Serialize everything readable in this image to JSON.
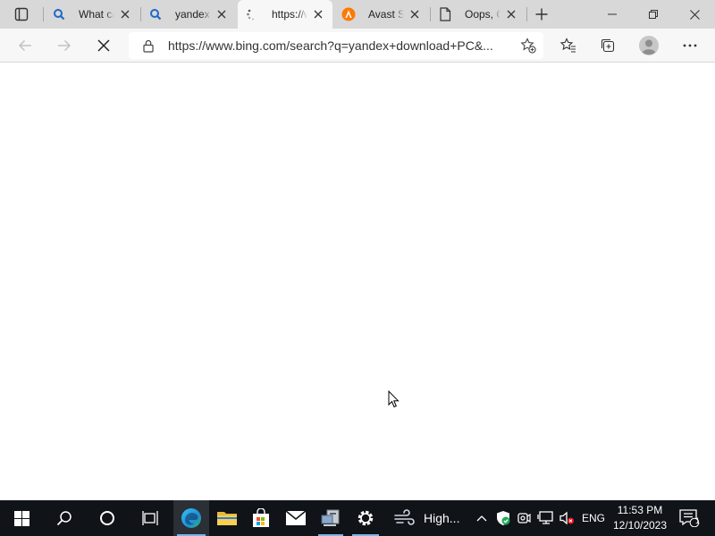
{
  "browser": {
    "tabs": [
      {
        "title": "What can",
        "icon": "search-icon",
        "active": false
      },
      {
        "title": "yandex",
        "icon": "search-icon",
        "active": false
      },
      {
        "title": "https://www",
        "icon": "loading-icon",
        "active": true
      },
      {
        "title": "Avast Sec",
        "icon": "avast-icon",
        "active": false
      },
      {
        "title": "Oops, C",
        "icon": "document-icon",
        "active": false
      }
    ],
    "address_bar": {
      "url": "https://www.bing.com/search?q=yandex+download+PC&..."
    }
  },
  "taskbar": {
    "weather_text": "High...",
    "language": "ENG",
    "time": "11:53 PM",
    "date": "12/10/2023",
    "notification_count": "1"
  },
  "colors": {
    "tabstrip_bg": "#d8d8d8",
    "toolbar_bg": "#f7f7f7",
    "taskbar_bg": "#101318",
    "accent": "#0078d4"
  }
}
